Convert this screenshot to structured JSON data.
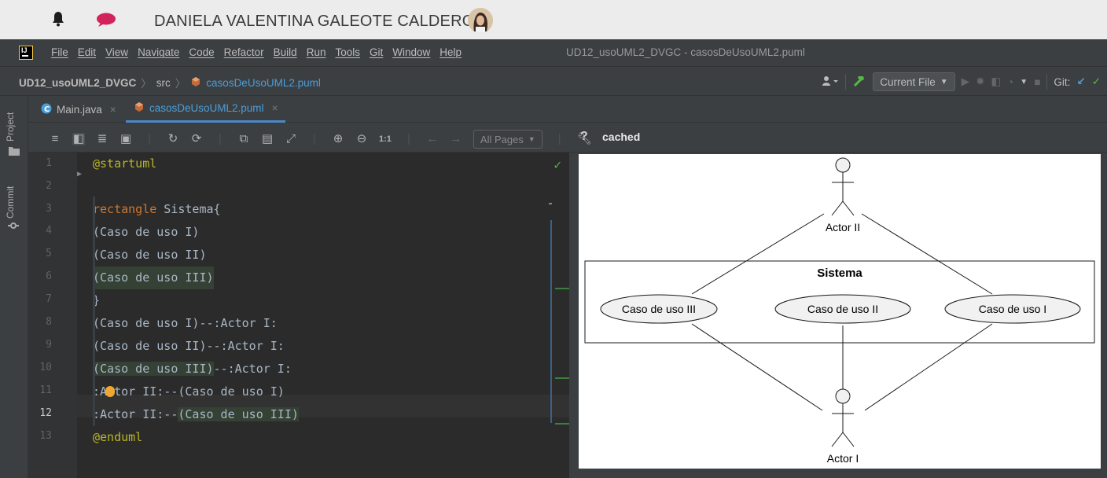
{
  "os": {
    "user_name": "DANIELA VALENTINA GALEOTE CALDERON"
  },
  "menu": {
    "items": [
      "File",
      "Edit",
      "View",
      "Navigate",
      "Code",
      "Refactor",
      "Build",
      "Run",
      "Tools",
      "Git",
      "Window",
      "Help"
    ],
    "window_title": "UD12_usoUML2_DVGC - casosDeUsoUML2.puml"
  },
  "nav": {
    "project": "UD12_usoUML2_DVGC",
    "folder": "src",
    "file": "casosDeUsoUML2.puml",
    "run_config": "Current File",
    "git_label": "Git:"
  },
  "toolstrip": {
    "project": "Project",
    "commit": "Commit"
  },
  "tabs": [
    {
      "label": "Main.java"
    },
    {
      "label": "casosDeUsoUML2.puml"
    }
  ],
  "editor_toolbar": {
    "pages_select": "All Pages",
    "zoom_reset": "1:1",
    "help": "?",
    "status": "cached"
  },
  "code": {
    "current_line": 12,
    "lines": [
      "@startuml",
      "",
      "rectangle Sistema{",
      "(Caso de uso I)",
      "(Caso de uso II)",
      "(Caso de uso III)",
      "}",
      "(Caso de uso I)--:Actor I:",
      "(Caso de uso II)--:Actor I:",
      "(Caso de uso III)--:Actor I:",
      ":Actor II:--(Caso de uso I)",
      ":Actor II:--(Caso de uso III)",
      "@enduml"
    ]
  },
  "diagram": {
    "system_title": "Sistema",
    "actor_top": "Actor II",
    "actor_bottom": "Actor I",
    "use_cases": [
      "Caso de uso III",
      "Caso de uso II",
      "Caso de uso I"
    ]
  },
  "colors": {
    "accent": "#4a88c7",
    "keyword": "#cc7832",
    "annotation": "#bbb529",
    "success": "#58b946"
  }
}
